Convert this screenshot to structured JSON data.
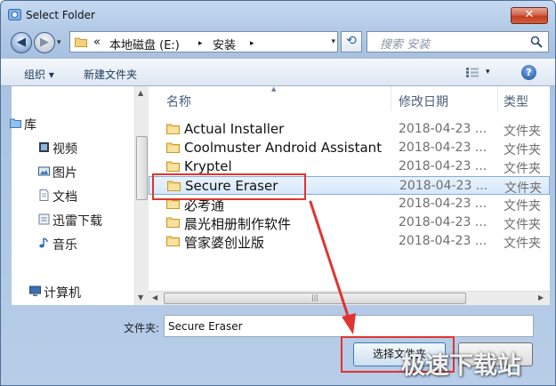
{
  "window": {
    "title": "Select Folder",
    "close_glyph": "✕"
  },
  "nav": {
    "back_glyph": "◀",
    "forward_glyph": "▶",
    "drop_glyph": "▾"
  },
  "address": {
    "overflow": "«",
    "crumbs": [
      "本地磁盘 (E:)",
      "安装"
    ],
    "separator": "▸",
    "drop_glyph": "▾"
  },
  "refresh_glyph": "⟲",
  "search": {
    "placeholder": "搜索 安装"
  },
  "toolbar": {
    "organize": "组织 ▾",
    "new_folder": "新建文件夹",
    "view_drop": "▾",
    "help": "?"
  },
  "sidebar": {
    "items": [
      {
        "label": "库",
        "icon": "library-icon"
      },
      {
        "label": "视频",
        "icon": "video-icon"
      },
      {
        "label": "图片",
        "icon": "picture-icon"
      },
      {
        "label": "文档",
        "icon": "document-icon"
      },
      {
        "label": "迅雷下载",
        "icon": "download-icon"
      },
      {
        "label": "音乐",
        "icon": "music-icon"
      },
      {
        "label": "计算机",
        "icon": "computer-icon"
      }
    ]
  },
  "columns": {
    "name": "名称",
    "date": "修改日期",
    "type": "类型"
  },
  "files": [
    {
      "name": "Actual Installer",
      "date": "2018-04-23 ...",
      "type": "文件夹"
    },
    {
      "name": "Coolmuster Android Assistant",
      "date": "2018-04-23 ...",
      "type": "文件夹"
    },
    {
      "name": "Kryptel",
      "date": "2018-04-23 ...",
      "type": "文件夹"
    },
    {
      "name": "Secure Eraser",
      "date": "2018-04-23 ...",
      "type": "文件夹"
    },
    {
      "name": "必考通",
      "date": "2018-04-23 ...",
      "type": "文件夹"
    },
    {
      "name": "晨光相册制作软件",
      "date": "2018-04-23 ...",
      "type": "文件夹"
    },
    {
      "name": "管家婆创业版",
      "date": "2018-04-23 ...",
      "type": "文件夹"
    }
  ],
  "selected_index": 3,
  "footer": {
    "folder_label": "文件夹:",
    "folder_value": "Secure Eraser",
    "select_button": "选择文件夹"
  },
  "watermark": "极速下载站",
  "colors": {
    "highlight": "#e0342f",
    "selection": "#d6e8fc",
    "accent": "#3c7fb1"
  }
}
